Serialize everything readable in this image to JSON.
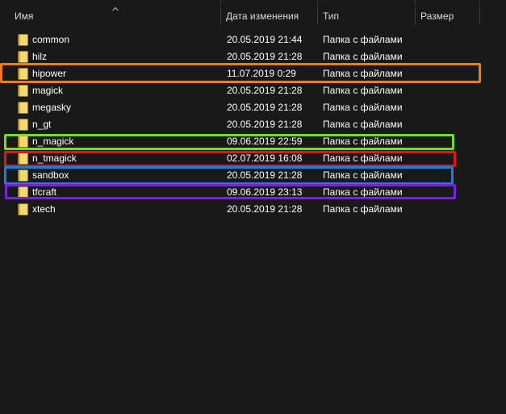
{
  "header": {
    "name_label": "Имя",
    "date_label": "Дата изменения",
    "type_label": "Тип",
    "size_label": "Размер"
  },
  "files": [
    {
      "name": "common",
      "date": "20.05.2019 21:44",
      "type": "Папка с файлами"
    },
    {
      "name": "hilz",
      "date": "20.05.2019 21:28",
      "type": "Папка с файлами"
    },
    {
      "name": "hipower",
      "date": "11.07.2019 0:29",
      "type": "Папка с файлами"
    },
    {
      "name": "magick",
      "date": "20.05.2019 21:28",
      "type": "Папка с файлами"
    },
    {
      "name": "megasky",
      "date": "20.05.2019 21:28",
      "type": "Папка с файлами"
    },
    {
      "name": "n_gt",
      "date": "20.05.2019 21:28",
      "type": "Папка с файлами"
    },
    {
      "name": "n_magick",
      "date": "09.06.2019 22:59",
      "type": "Папка с файлами"
    },
    {
      "name": "n_tmagick",
      "date": "02.07.2019 16:08",
      "type": "Папка с файлами"
    },
    {
      "name": "sandbox",
      "date": "20.05.2019 21:28",
      "type": "Папка с файлами"
    },
    {
      "name": "tfcraft",
      "date": "09.06.2019 23:13",
      "type": "Папка с файлами"
    },
    {
      "name": "xtech",
      "date": "20.05.2019 21:28",
      "type": "Папка с файлами"
    }
  ],
  "highlights": [
    {
      "row": "hipower",
      "color": "#f07c12"
    },
    {
      "row": "n_magick",
      "color": "#73e11f"
    },
    {
      "row": "n_tmagick",
      "color": "#e01818"
    },
    {
      "row": "sandbox",
      "color": "#1a7fe0"
    },
    {
      "row": "tfcraft",
      "color": "#7b1fe0"
    }
  ],
  "icons": {
    "folder": "folder-icon",
    "sort": "sort-up-icon"
  },
  "colors": {
    "background": "#191919",
    "folder_light": "#f4d86a",
    "folder_dark": "#d9b23e"
  }
}
